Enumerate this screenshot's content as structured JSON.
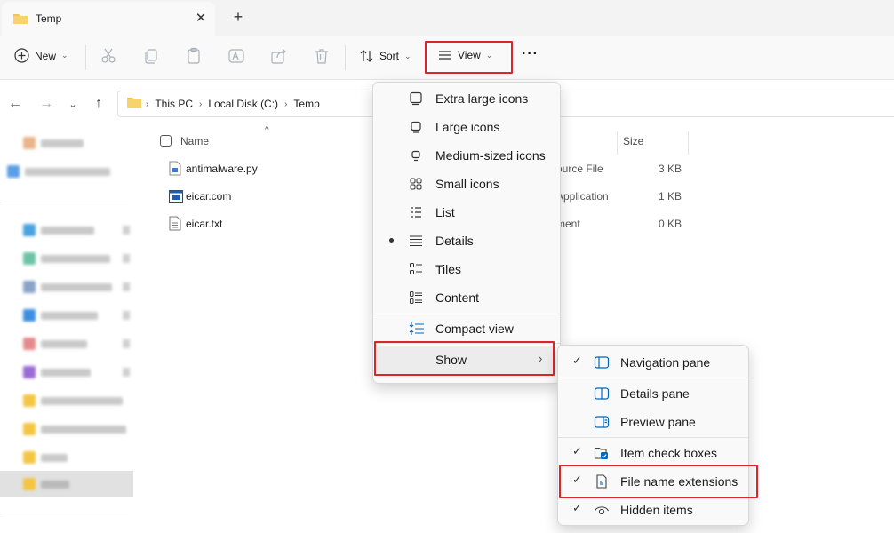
{
  "tab": {
    "title": "Temp",
    "close_label": "✕",
    "new_tab_label": "+"
  },
  "toolbar": {
    "new_label": "New",
    "sort_label": "Sort",
    "view_label": "View",
    "more_label": "···"
  },
  "address": {
    "crumbs": [
      "This PC",
      "Local Disk (C:)",
      "Temp"
    ]
  },
  "columns": {
    "name": "Name",
    "size": "Size"
  },
  "files": [
    {
      "name": "antimalware.py",
      "type": "ource File",
      "size": "3 KB",
      "icon": "python-file-icon"
    },
    {
      "name": "eicar.com",
      "type": "Application",
      "size": "1 KB",
      "icon": "application-file-icon"
    },
    {
      "name": "eicar.txt",
      "type": "ment",
      "size": "0 KB",
      "icon": "text-file-icon"
    }
  ],
  "view_menu": {
    "items": [
      {
        "label": "Extra large icons",
        "icon": "monitor-large-icon",
        "selected": false
      },
      {
        "label": "Large icons",
        "icon": "monitor-icon",
        "selected": false
      },
      {
        "label": "Medium-sized icons",
        "icon": "monitor-small-icon",
        "selected": false
      },
      {
        "label": "Small icons",
        "icon": "small-icons-grid-icon",
        "selected": false
      },
      {
        "label": "List",
        "icon": "list-icon",
        "selected": false
      },
      {
        "label": "Details",
        "icon": "details-icon",
        "selected": true
      },
      {
        "label": "Tiles",
        "icon": "tiles-icon",
        "selected": false
      },
      {
        "label": "Content",
        "icon": "content-icon",
        "selected": false
      }
    ],
    "compact_label": "Compact view",
    "show_label": "Show"
  },
  "show_menu": {
    "items": [
      {
        "label": "Navigation pane",
        "checked": true,
        "icon": "navigation-pane-icon"
      },
      {
        "label": "Details pane",
        "checked": false,
        "icon": "details-pane-icon"
      },
      {
        "label": "Preview pane",
        "checked": false,
        "icon": "preview-pane-icon"
      },
      {
        "label": "Item check boxes",
        "checked": true,
        "icon": "item-checkbox-icon"
      },
      {
        "label": "File name extensions",
        "checked": true,
        "icon": "file-extension-icon"
      },
      {
        "label": "Hidden items",
        "checked": true,
        "icon": "eye-icon"
      }
    ]
  },
  "colors": {
    "accent": "#0067c0",
    "highlight_box": "#d9262a",
    "folder": "#f4c542"
  }
}
